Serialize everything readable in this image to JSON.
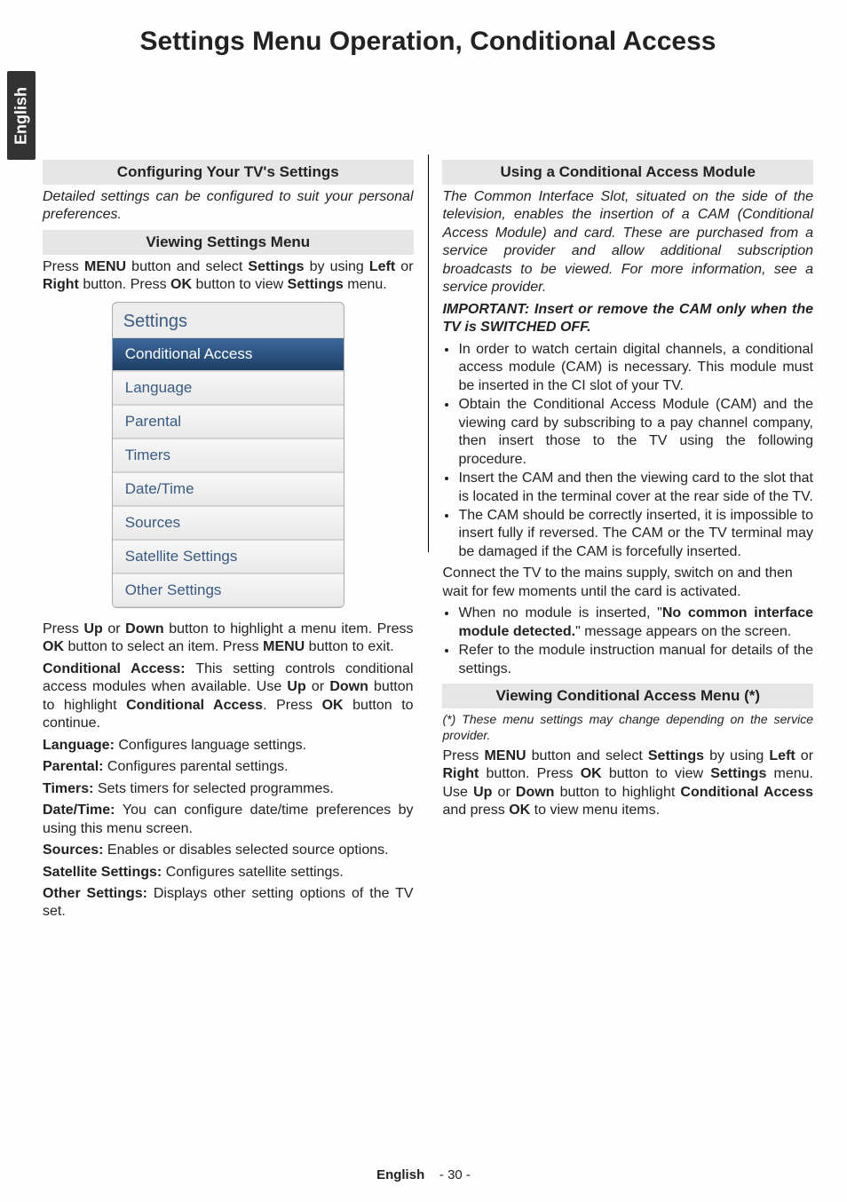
{
  "side_tab": "English",
  "page_title": "Settings Menu Operation, Conditional Access",
  "left": {
    "h_configuring": "Configuring Your TV's Settings",
    "intro": "Detailed settings can be configured to suit your personal preferences.",
    "h_viewing": "Viewing Settings Menu",
    "viewing_p1_a": "Press ",
    "viewing_p1_b": "MENU",
    "viewing_p1_c": " button and select ",
    "viewing_p1_d": "Settings",
    "viewing_p1_e": " by using ",
    "viewing_p1_f": "Left",
    "viewing_p1_g": " or ",
    "viewing_p1_h": "Right",
    "viewing_p1_i": " button. Press ",
    "viewing_p1_j": "OK",
    "viewing_p1_k": " button to view ",
    "viewing_p1_l": "Settings",
    "viewing_p1_m": " menu.",
    "menu": {
      "title": "Settings",
      "items": [
        "Conditional Access",
        "Language",
        "Parental",
        "Timers",
        "Date/Time",
        "Sources",
        "Satellite Settings",
        "Other Settings"
      ]
    },
    "nav_p_a": "Press ",
    "nav_p_b": "Up",
    "nav_p_c": " or ",
    "nav_p_d": "Down",
    "nav_p_e": " button to highlight a menu item. Press ",
    "nav_p_f": "OK",
    "nav_p_g": " button to select an item. Press ",
    "nav_p_h": "MENU",
    "nav_p_i": " button to exit.",
    "ca_label": "Conditional Access: ",
    "ca_a": "This setting controls conditional access modules when available. Use ",
    "ca_b": "Up",
    "ca_c": " or ",
    "ca_d": "Down",
    "ca_e": " button to highlight ",
    "ca_f": "Conditional Access",
    "ca_g": ". Press ",
    "ca_h": "OK",
    "ca_i": " button to continue.",
    "lang_label": "Language: ",
    "lang_text": "Configures language settings.",
    "par_label": "Parental: ",
    "par_text": "Configures parental settings.",
    "tim_label": "Timers: ",
    "tim_text": "Sets timers for selected programmes.",
    "dt_label": "Date/Time: ",
    "dt_text": "You can configure date/time preferences by using this menu screen.",
    "src_label": "Sources: ",
    "src_text": "Enables or disables selected source options.",
    "sat_label": "Satellite Settings: ",
    "sat_text": "Configures satellite settings.",
    "oth_label": "Other Settings: ",
    "oth_text": "Displays other setting options of the TV set."
  },
  "right": {
    "h_using": "Using a Conditional Access Module",
    "intro": "The Common Interface Slot, situated on the side of the television, enables the insertion of a CAM (Conditional Access Module) and card. These are purchased from a service provider and allow additional subscription broadcasts to be viewed. For more information, see a service provider.",
    "important": "IMPORTANT: Insert or remove the CAM only when the TV is SWITCHED OFF.",
    "b1": "In order to watch certain digital channels, a conditional access module (CAM) is necessary. This module must be inserted in the CI slot of your TV.",
    "b2": "Obtain the Conditional Access Module (CAM) and the viewing card by subscribing to a pay channel company, then insert those to the TV using the following procedure.",
    "b3": "Insert the CAM and then the viewing card to the slot that is located in the terminal cover at the rear side of the TV.",
    "b4": "The CAM should be correctly inserted, it is impossible to insert fully if reversed. The CAM or the TV terminal may be damaged if the CAM is forcefully inserted.",
    "after_b4": "Connect the TV to the mains supply, switch on and then wait for few moments until the card is activated.",
    "b5_a": "When no module is inserted, \"",
    "b5_b": "No common interface module detected.",
    "b5_c": "\" message appears on the screen.",
    "b6": "Refer to the module instruction manual for details of the settings.",
    "h_viewing_ca": "Viewing Conditional Access Menu (*)",
    "footnote": "(*) These menu settings may change depending on the service provider.",
    "last_a": "Press ",
    "last_b": "MENU",
    "last_c": " button and select ",
    "last_d": "Settings",
    "last_e": " by using ",
    "last_f": "Left",
    "last_g": " or ",
    "last_h": "Right",
    "last_i": " button. Press ",
    "last_j": "OK",
    "last_k": " button to view ",
    "last_l": "Settings",
    "last_m": " menu. Use ",
    "last_n": "Up",
    "last_o": " or ",
    "last_p": "Down",
    "last_q": " button to highlight ",
    "last_r": "Conditional Access",
    "last_s": " and press ",
    "last_t": "OK",
    "last_u": " to view menu items."
  },
  "footer": {
    "lang": "English",
    "page": "- 30 -"
  }
}
